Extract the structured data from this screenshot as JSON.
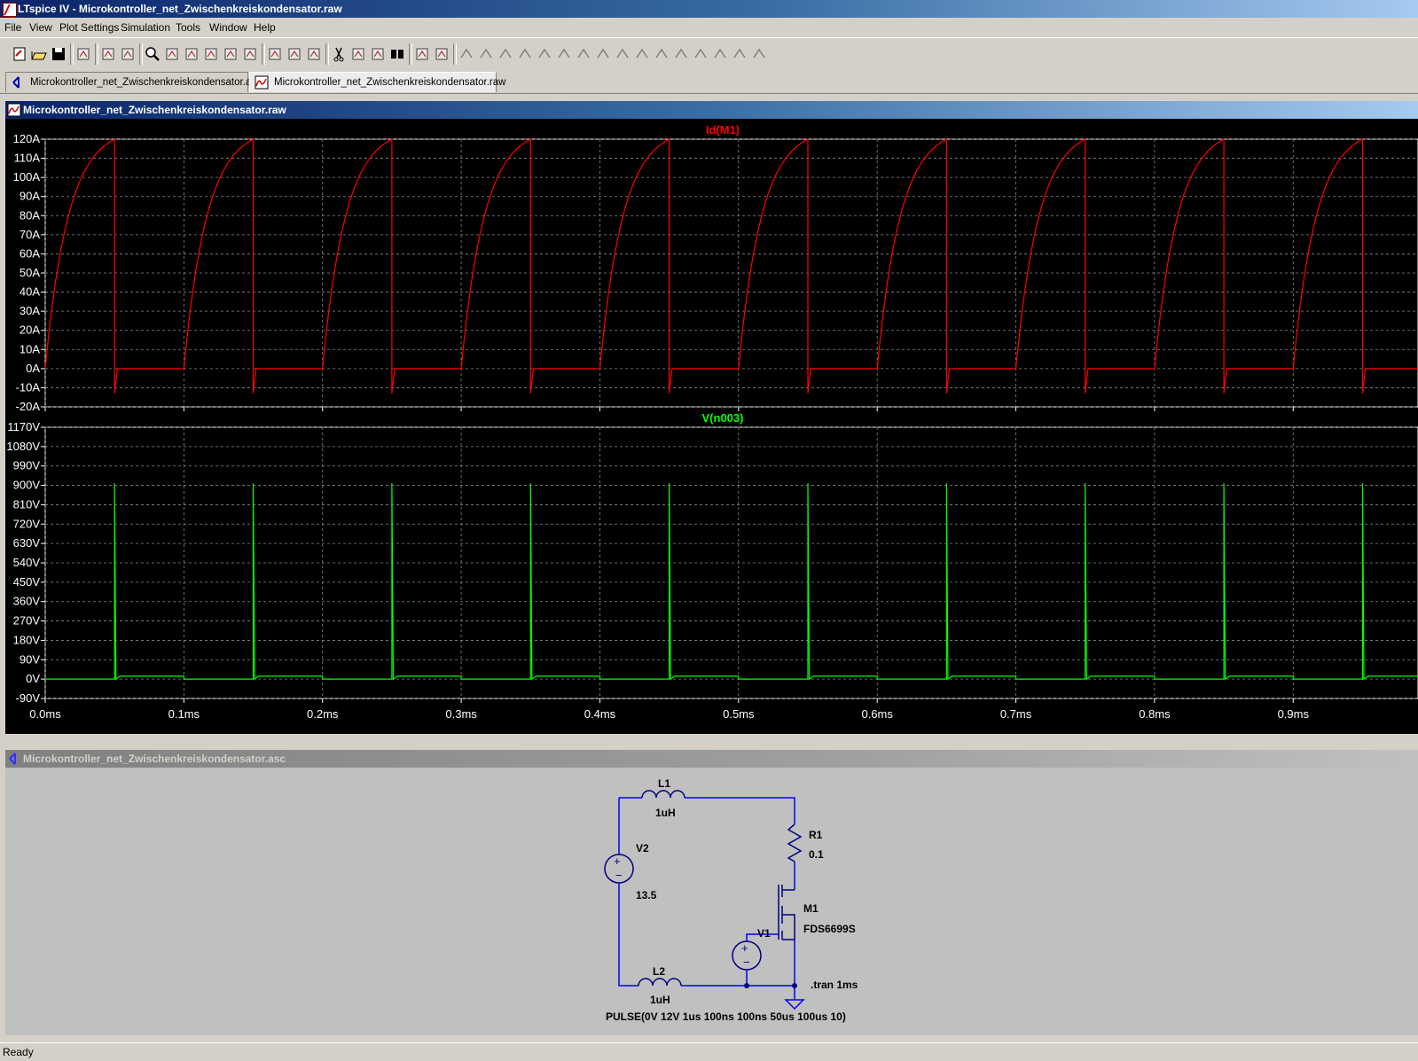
{
  "window": {
    "title": "LTspice IV - Microkontroller_net_Zwischenkreiskondensator.raw"
  },
  "menu": [
    {
      "label": "File"
    },
    {
      "label": "View"
    },
    {
      "label": "Plot Settings"
    },
    {
      "label": "Simulation"
    },
    {
      "label": "Tools"
    },
    {
      "label": "Window"
    },
    {
      "label": "Help"
    }
  ],
  "toolbar": {
    "icons": [
      "new-schematic-icon",
      "open-icon",
      "save-icon",
      "control-panel-icon",
      "run-icon",
      "halt-icon",
      "zoom-in-icon",
      "zoom-box-icon",
      "zoom-out-icon",
      "zoom-cancel-icon",
      "autorange-icon",
      "zoom-full-icon",
      "tile-horizontal-icon",
      "cascade-icon",
      "tile-vertical-icon",
      "cut-icon",
      "copy-icon",
      "paste-icon",
      "find-icon",
      "print-setup-icon",
      "print-icon",
      "wire-icon",
      "ground-icon",
      "label-icon",
      "resistor-icon",
      "capacitor-icon",
      "inductor-icon",
      "diode-icon",
      "component-icon",
      "move-icon",
      "drag-icon",
      "undo-icon",
      "redo-icon",
      "rotate-icon",
      "mirror-icon",
      "text-icon",
      "spice-directive-icon"
    ]
  },
  "tabs": [
    {
      "label": "Microkontroller_net_Zwischenkreiskondensator.asc"
    },
    {
      "label": "Microkontroller_net_Zwischenkreiskondensator.raw"
    }
  ],
  "plot_window": {
    "title": "Microkontroller_net_Zwischenkreiskondensator.raw"
  },
  "schematic_window": {
    "title": "Microkontroller_net_Zwischenkreiskondensator.asc"
  },
  "chart_data": [
    {
      "type": "line",
      "title": "Id(M1)",
      "color": "#ff0000",
      "y_ticks": [
        "120A",
        "110A",
        "100A",
        "90A",
        "80A",
        "70A",
        "60A",
        "50A",
        "40A",
        "30A",
        "20A",
        "10A",
        "0A",
        "-10A",
        "-20A"
      ],
      "ylim": [
        -20,
        120
      ],
      "x_ticks": [
        "0.0ms",
        "0.1ms",
        "0.2ms",
        "0.3ms",
        "0.4ms",
        "0.5ms",
        "0.6ms",
        "0.7ms",
        "0.8ms",
        "0.9ms"
      ],
      "xlim_ms": [
        0,
        0.99
      ],
      "period_ms": 0.1,
      "pulse_on_ms": 0.05,
      "peak_A": 120,
      "turnoff_undershoot_A": -13,
      "off_level_A": 0
    },
    {
      "type": "line",
      "title": "V(n003)",
      "color": "#00ff00",
      "y_ticks": [
        "1170V",
        "1080V",
        "990V",
        "900V",
        "810V",
        "720V",
        "630V",
        "540V",
        "450V",
        "360V",
        "270V",
        "180V",
        "90V",
        "0V",
        "-90V"
      ],
      "ylim": [
        -90,
        1170
      ],
      "x_ticks": [
        "0.0ms",
        "0.1ms",
        "0.2ms",
        "0.3ms",
        "0.4ms",
        "0.5ms",
        "0.6ms",
        "0.7ms",
        "0.8ms",
        "0.9ms"
      ],
      "xlim_ms": [
        0,
        0.99
      ],
      "spike_times_ms": [
        0.05,
        0.15,
        0.25,
        0.35,
        0.45,
        0.55,
        0.65,
        0.75,
        0.85,
        0.95
      ],
      "spike_peak_V": 910,
      "on_level_V": 0,
      "off_level_V": 13.5
    }
  ],
  "schematic": {
    "L1": {
      "name": "L1",
      "value": "1uH"
    },
    "L2": {
      "name": "L2",
      "value": "1uH"
    },
    "R1": {
      "name": "R1",
      "value": "0.1"
    },
    "V2": {
      "name": "V2",
      "value": "13.5"
    },
    "V1": {
      "name": "V1",
      "value": "PULSE(0V 12V 1us 100ns 100ns 50us 100us 10)"
    },
    "M1": {
      "name": "M1",
      "value": "FDS6699S"
    },
    "directive": ".tran 1ms"
  },
  "status": {
    "text": "Ready"
  }
}
